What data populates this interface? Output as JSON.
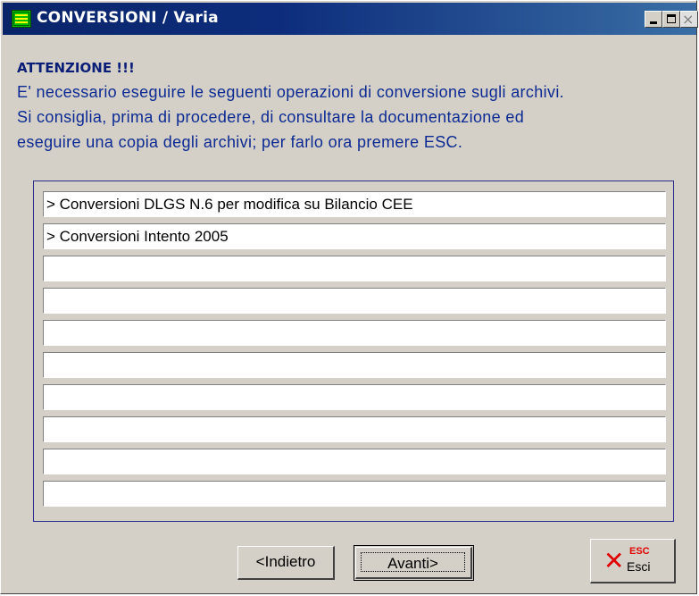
{
  "window": {
    "title": "CONVERSIONI / Varia",
    "controls": {
      "minimize": "minimize-icon",
      "maximize": "maximize-icon",
      "close": "×"
    }
  },
  "header": {
    "attention": "ATTENZIONE !!!",
    "lines": [
      "E' necessario eseguire le seguenti operazioni di conversione sugli archivi.",
      "Si consiglia, prima di procedere, di  consultare la documentazione ed",
      "eseguire una copia degli archivi; per farlo ora premere ESC."
    ]
  },
  "conversions": {
    "items": [
      "> Conversioni DLGS N.6 per modifica su Bilancio CEE",
      "> Conversioni Intento 2005",
      "",
      "",
      "",
      "",
      "",
      "",
      "",
      ""
    ]
  },
  "buttons": {
    "back": "<Indietro",
    "next": "Avanti>",
    "exit_key": "ESC",
    "exit_label": "Esci",
    "exit_icon": "x-icon"
  },
  "colors": {
    "title_bar": "#0a246a",
    "message_text": "#0c2a92",
    "exit_icon": "#e00000",
    "window_bg": "#d4d0c8"
  }
}
